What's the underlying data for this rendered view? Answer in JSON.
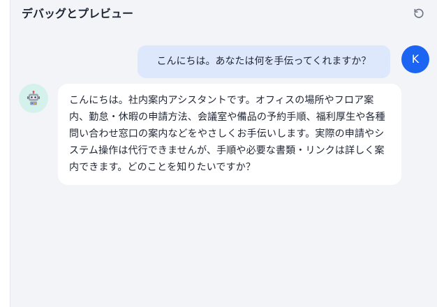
{
  "header": {
    "title": "デバッグとプレビュー",
    "refresh_icon": "refresh-icon"
  },
  "messages": [
    {
      "role": "user",
      "avatar_initial": "K",
      "text": "こんにちは。あなたは何を手伝ってくれますか？"
    },
    {
      "role": "assistant",
      "avatar_icon": "robot-icon",
      "text": "こんにちは。社内案内アシスタントです。オフィスの場所やフロア案内、勤怠・休暇の申請方法、会議室や備品の予約手順、福利厚生や各種問い合わせ窓口の案内などをやさしくお手伝いします。実際の申請やシステム操作は代行できませんが、手順や必要な書類・リンクは詳しく案内できます。どのことを知りたいですか？"
    }
  ],
  "colors": {
    "panel_bg": "#f3f4f7",
    "user_bubble": "#dde8fc",
    "user_avatar": "#1c64f2",
    "bot_avatar_bg": "#d5f1ec",
    "bot_bubble": "#ffffff"
  }
}
